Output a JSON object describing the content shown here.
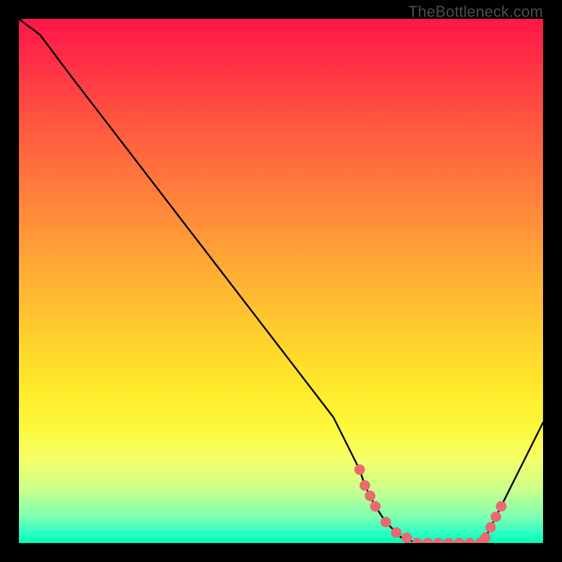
{
  "watermark": "TheBottleneck.com",
  "colors": {
    "curve_stroke": "#000000",
    "marker_fill": "#e96a71",
    "marker_stroke": "#e96a71"
  },
  "chart_data": {
    "type": "line",
    "title": "",
    "xlabel": "",
    "ylabel": "",
    "xlim": [
      0,
      100
    ],
    "ylim": [
      0,
      100
    ],
    "grid": false,
    "series": [
      {
        "name": "bottleneck-curve",
        "x": [
          0,
          4,
          10,
          20,
          30,
          40,
          50,
          60,
          65,
          66,
          67,
          68,
          70,
          73,
          76,
          79,
          82,
          85,
          88,
          89,
          90,
          92,
          95,
          100
        ],
        "y": [
          100,
          97,
          89,
          76,
          63,
          50,
          37,
          24,
          14,
          11,
          9,
          7,
          4,
          1,
          0,
          0,
          0,
          0,
          0,
          1,
          3,
          7,
          13,
          23
        ]
      }
    ],
    "markers": {
      "name": "highlighted-points",
      "x": [
        65,
        66,
        67,
        68,
        70,
        72,
        74,
        76,
        78,
        80,
        82,
        84,
        86,
        88,
        89,
        90,
        91,
        92
      ],
      "y": [
        14,
        11,
        9,
        7,
        4,
        2,
        1,
        0,
        0,
        0,
        0,
        0,
        0,
        0,
        1,
        3,
        5,
        7
      ]
    }
  }
}
